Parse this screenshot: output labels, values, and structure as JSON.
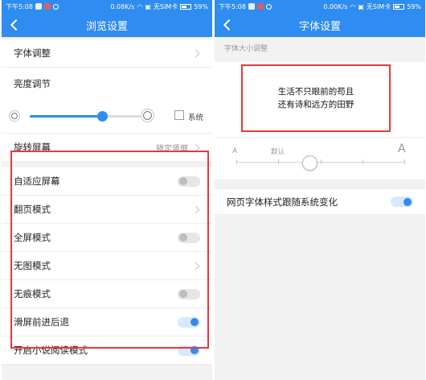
{
  "status_bar": {
    "left": {
      "time": "下午5:08",
      "speed": "0.08K/s",
      "sim": "无SIM卡",
      "battery": "59%"
    },
    "right": {
      "time": "下午5:08",
      "speed": "0.00K/s",
      "sim": "无SIM卡",
      "battery": "59%"
    },
    "battery_level": 0.59
  },
  "browse_settings": {
    "title": "浏览设置",
    "font_adjust": "字体调整",
    "brightness": {
      "label": "亮度调节",
      "level": 0.65,
      "system_label": "系统",
      "system_checked": false
    },
    "rotate": {
      "label": "旋转屏幕",
      "value": "锁定竖屏"
    },
    "items": [
      {
        "label": "自适应屏幕",
        "control": "toggle",
        "on": false
      },
      {
        "label": "翻页模式",
        "control": "chevron"
      },
      {
        "label": "全屏模式",
        "control": "toggle",
        "on": false
      },
      {
        "label": "无图模式",
        "control": "chevron"
      },
      {
        "label": "无痕模式",
        "control": "toggle",
        "on": false
      },
      {
        "label": "滑屏前进后退",
        "control": "toggle",
        "on": true
      },
      {
        "label": "开启小说阅读模式",
        "control": "toggle",
        "on": true
      }
    ]
  },
  "font_settings": {
    "title": "字体设置",
    "section_label": "字体大小调整",
    "preview_line1": "生活不只眼前的苟且",
    "preview_line2": "还有诗和远方的田野",
    "size_small": "A",
    "size_default": "默认",
    "size_large": "A",
    "follow_system": {
      "label": "网页字体样式跟随系统变化",
      "on": true
    }
  },
  "colors": {
    "accent": "#2f8cf0",
    "highlight": "#e5393b"
  }
}
